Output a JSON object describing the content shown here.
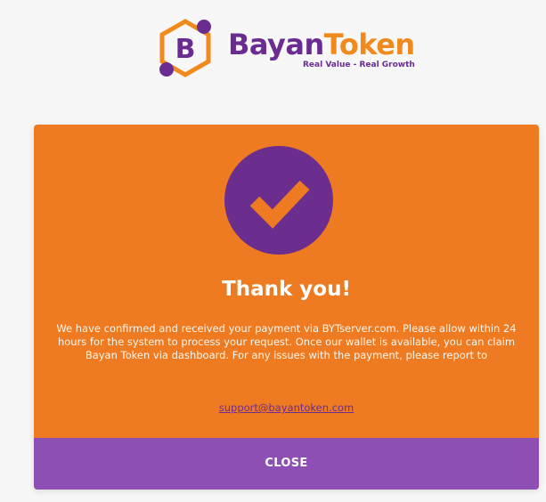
{
  "header": {
    "brand_part1": "Bayan",
    "brand_part2": "Token",
    "tagline": "Real Value - Real Growth",
    "logo_icon": "bayan-hex-b-icon"
  },
  "modal": {
    "icon": "check-icon",
    "title": "Thank you!",
    "message": "We have confirmed and received your payment via BYTserver.com. Please allow within 24 hours for the system to process your request. Once our wallet is available, you can claim Bayan Token via dashboard. For any issues with the payment, please report to",
    "support_email": "support@bayantoken.com",
    "close_label": "CLOSE"
  },
  "colors": {
    "brand_purple": "#6a2c91",
    "brand_orange": "#f08a1c",
    "modal_orange": "#ee7b22",
    "close_bar_purple": "#8d4fb4"
  }
}
